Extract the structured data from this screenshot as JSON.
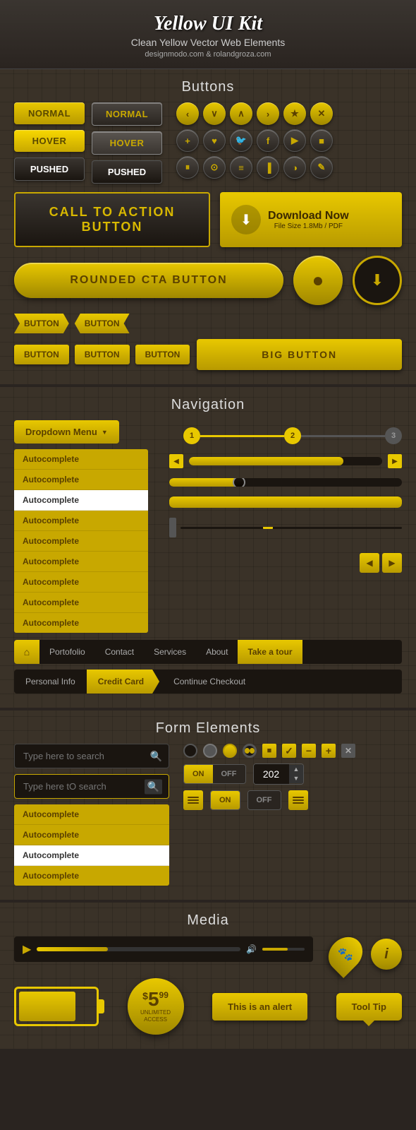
{
  "header": {
    "title": "Yellow UI Kit",
    "subtitle": "Clean Yellow Vector Web Elements",
    "attribution": "designmodo.com & rolandgroza.com"
  },
  "sections": {
    "buttons": {
      "title": "Buttons",
      "col1": [
        "Normal",
        "Hover",
        "Pushed"
      ],
      "col2": [
        "Normal",
        "Hover",
        "Pushed"
      ],
      "cta_label": "CALL TO ACTION BUTTON",
      "download_label": "Download Now",
      "download_sub": "File Size 1.8Mb / PDF",
      "rounded_cta": "ROUNDED CTA BUTTON",
      "button_label": "Button",
      "big_button": "BIG BUTTON"
    },
    "navigation": {
      "title": "Navigation",
      "dropdown": "Dropdown Menu",
      "steps": [
        "1",
        "2",
        "3"
      ],
      "autocomplete_items": [
        "Autocomplete",
        "Autocomplete",
        "Autocomplete",
        "Autocomplete",
        "Autocomplete",
        "Autocomplete",
        "Autocomplete",
        "Autocomplete",
        "Autocomplete"
      ],
      "active_index": 2,
      "nav_items": [
        "Portofolio",
        "Contact",
        "Services",
        "About",
        "Take a tour"
      ],
      "breadcrumb": [
        "Personal Info",
        "Credit Card",
        "Continue Checkout"
      ],
      "breadcrumb_active": 1
    },
    "form": {
      "title": "Form Elements",
      "placeholder1": "Type here to search",
      "placeholder2": "Type here tO search",
      "autocomplete_items": [
        "Autocomplete",
        "Autocomplete",
        "Autocomplete",
        "Autocomplete"
      ],
      "active_index": 2,
      "toggle_on": "ON",
      "toggle_off": "OFF",
      "number_value": "202"
    },
    "media": {
      "title": "Media",
      "price_main": "$5",
      "price_sup": "99",
      "price_sub": "UNLIMITED\nACCESS",
      "alert_label": "This is an alert",
      "tooltip_label": "Tool Tip"
    }
  },
  "icons": {
    "row1": [
      "‹",
      "∨",
      "∧",
      "›",
      "★",
      "✕"
    ],
    "row2": [
      "+",
      "♥",
      "🐦",
      "f",
      "▶",
      "■"
    ],
    "row3": [
      "⏸",
      "⊙",
      "≡",
      "▐",
      "◑",
      "✎"
    ]
  }
}
